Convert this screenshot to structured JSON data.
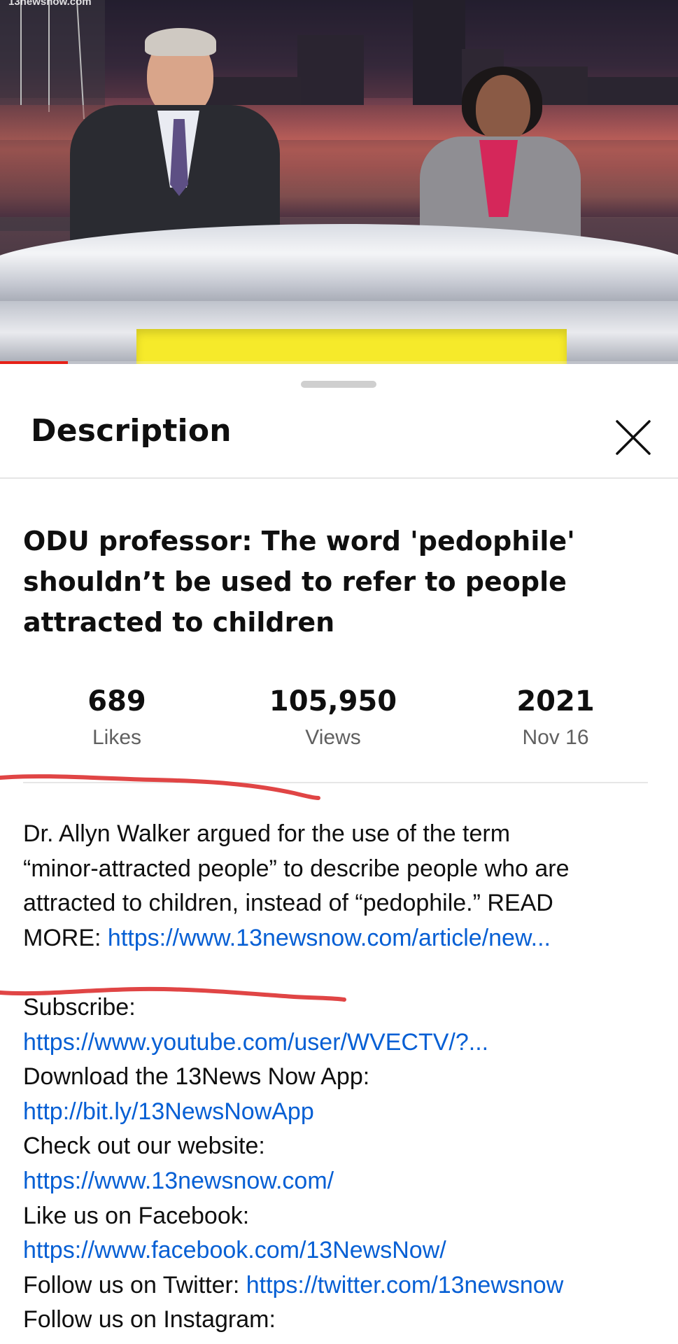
{
  "video": {
    "watermark": "13newsnow.com",
    "progress_fraction": 0.1
  },
  "sheet": {
    "title": "Description",
    "close_icon": "close-icon"
  },
  "video_title": "ODU professor: The word 'pedophile' shouldn’t be used to refer to people attracted to children",
  "stats": [
    {
      "value": "689",
      "label": "Likes"
    },
    {
      "value": "105,950",
      "label": "Views"
    },
    {
      "value": "2021",
      "label": "Nov 16"
    }
  ],
  "description": {
    "line1": "Dr. Allyn Walker argued for the use of the term",
    "line2": "“minor-attracted people” to describe people who are",
    "line3": "attracted to children, instead of “pedophile.” READ",
    "line4_prefix": "MORE: ",
    "line4_link": "https://www.13newsnow.com/article/new..."
  },
  "links_section": {
    "subscribe_label": "Subscribe:",
    "subscribe_link": "https://www.youtube.com/user/WVECTV/?...",
    "app_label": "Download the 13News Now App:",
    "app_link": "http://bit.ly/13NewsNowApp",
    "website_label": "Check out our website:",
    "website_link": "https://www.13newsnow.com/",
    "facebook_label": "Like us on Facebook:",
    "facebook_link": "https://www.facebook.com/13NewsNow/",
    "twitter_label": "Follow us on Twitter: ",
    "twitter_link": "https://twitter.com/13newsnow",
    "instagram_label": "Follow us on Instagram:"
  },
  "colors": {
    "link": "#065fd4",
    "annotation_red": "#e04545",
    "progress_red": "#e62117"
  }
}
